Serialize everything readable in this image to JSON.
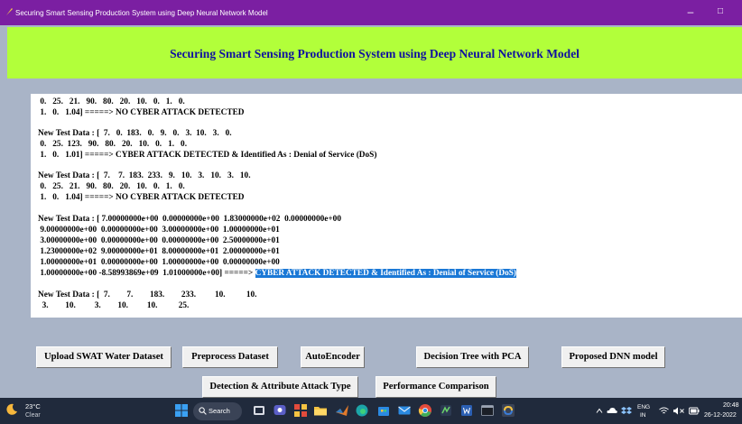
{
  "window": {
    "title": "Securing Smart Sensing Production System using Deep Neural Network Model",
    "minimize_glyph": "–",
    "maximize_glyph": "□"
  },
  "header": {
    "title": "Securing Smart Sensing Production System using Deep Neural Network Model"
  },
  "output": {
    "lines": [
      " 0.   25.   21.   90.   80.   20.   10.   0.   1.   0.",
      " 1.   0.   1.04] =====> NO CYBER ATTACK DETECTED",
      "New Test Data : [  7.   0.  183.   0.   9.   0.   3.  10.   3.   0.",
      " 0.   25.  123.   90.   80.   20.   10.   0.   1.   0.",
      " 1.   0.   1.01] =====> CYBER ATTACK DETECTED & Identified As : Denial of Service (DoS)",
      "New Test Data : [  7.    7.  183.  233.   9.   10.   3.   10.   3.   10.",
      " 0.   25.   21.   90.   80.   20.   10.   0.   1.   0.",
      " 1.   0.   1.04] =====> NO CYBER ATTACK DETECTED",
      "New Test Data : [ 7.00000000e+00  0.00000000e+00  1.83000000e+02  0.00000000e+00",
      " 9.00000000e+00  0.00000000e+00  3.00000000e+00  1.00000000e+01",
      " 3.00000000e+00  0.00000000e+00  0.00000000e+00  2.50000000e+01",
      " 1.23000000e+02  9.00000000e+01  8.00000000e+01  2.00000000e+01",
      " 1.00000000e+01  0.00000000e+00  1.00000000e+00  0.00000000e+00",
      " 1.00000000e+00 -8.58993869e+09  1.01000000e+00] =====> ",
      "New Test Data : [  7.        7.        183.        233.         10.          10.",
      "  3.        10.         3.        10.         10.          25."
    ],
    "highlighted": "CYBER ATTACK DETECTED & Identified As : Denial of Service (DoS)"
  },
  "buttons": {
    "upload": "Upload SWAT Water Dataset",
    "preprocess": "Preprocess Dataset",
    "autoencoder": "AutoEncoder",
    "dtpca": "Decision Tree with PCA",
    "dnn": "Proposed DNN model",
    "detection": "Detection & Attribute Attack Type",
    "performance": "Performance Comparison"
  },
  "taskbar": {
    "temperature": "23°C",
    "condition": "Clear",
    "search": "Search",
    "lang": "ENG",
    "region": "IN",
    "time": "20:48",
    "date": "26-12-2022",
    "icons": [
      "windows-start-icon",
      "task-view-icon",
      "chat-icon",
      "widgets-icon",
      "file-explorer-icon",
      "matlab-icon",
      "edge-icon",
      "store-icon",
      "mail-icon",
      "chrome-icon",
      "app-icon",
      "word-icon",
      "terminal-icon",
      "python-icon"
    ]
  }
}
